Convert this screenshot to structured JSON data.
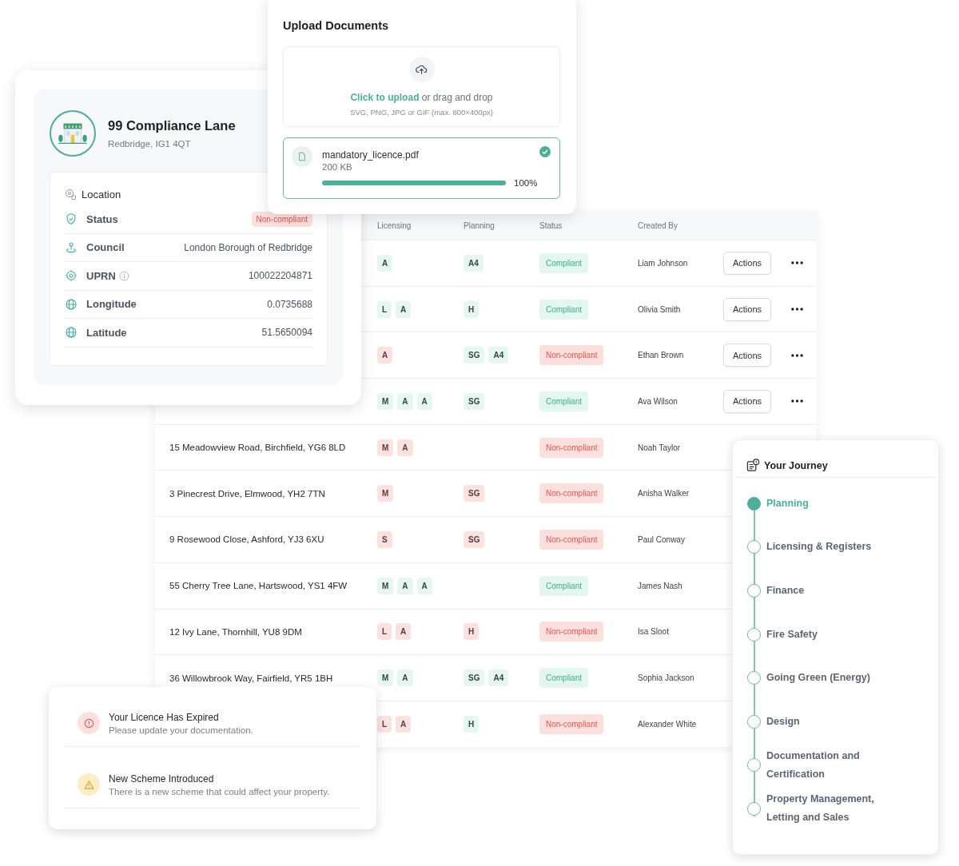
{
  "property": {
    "title": "99 Compliance Lane",
    "subtitle": "Redbridge, IG1 4QT",
    "section": "Location",
    "rows": [
      {
        "kind": "status",
        "label": "Status",
        "value": "Non-compliant",
        "info": false
      },
      {
        "kind": "council",
        "label": "Council",
        "value": "London Borough of Redbridge",
        "info": false
      },
      {
        "kind": "uprn",
        "label": "UPRN",
        "value": "100022204871",
        "info": true
      },
      {
        "kind": "globe",
        "label": "Longitude",
        "value": "0.0735688",
        "info": false
      },
      {
        "kind": "globe",
        "label": "Latitude",
        "value": "51.5650094",
        "info": false
      }
    ]
  },
  "upload": {
    "title": "Upload Documents",
    "link": "Click to upload",
    "prompt": "or drag and drop",
    "hint": "SVG, PNG, JPG or GIF (max. 800×400px)",
    "file": {
      "name": "mandatory_licence.pdf",
      "size": "200 KB",
      "level": 1,
      "percent": "100%",
      "complete": true
    }
  },
  "table": {
    "columns": [
      "Licensing",
      "Planning",
      "Status",
      "Created By"
    ],
    "rows": [
      {
        "licensing": {
          "tags": [
            "A"
          ],
          "flagged": false
        },
        "planning": {
          "tags": [
            "A4"
          ],
          "flagged": false
        },
        "status": {
          "label": "Compliant",
          "compliant": true
        },
        "created_by": "Liam Johnson",
        "actions": "Actions"
      },
      {
        "licensing": {
          "tags": [
            "L",
            "A"
          ],
          "flagged": false
        },
        "planning": {
          "tags": [
            "H"
          ],
          "flagged": false
        },
        "status": {
          "label": "Compliant",
          "compliant": true
        },
        "created_by": "Olivia Smith",
        "actions": "Actions"
      },
      {
        "licensing": {
          "tags": [
            "A"
          ],
          "flagged": true
        },
        "planning": {
          "tags": [
            "SG",
            "A4"
          ],
          "flagged": false
        },
        "status": {
          "label": "Non-compliant",
          "compliant": false
        },
        "created_by": "Ethan Brown",
        "actions": "Actions"
      },
      {
        "licensing": {
          "tags": [
            "M",
            "A",
            "A"
          ],
          "flagged": false
        },
        "planning": {
          "tags": [
            "SG"
          ],
          "flagged": false
        },
        "status": {
          "label": "Compliant",
          "compliant": true
        },
        "created_by": "Ava Wilson",
        "actions": "Actions"
      },
      {
        "address": "15 Meadowview Road, Birchfield, YG6 8LD",
        "licensing": {
          "tags": [
            "M",
            "A"
          ],
          "flagged": true
        },
        "status": {
          "label": "Non-compliant",
          "compliant": false
        },
        "created_by": "Noah Taylor"
      },
      {
        "address": "3 Pinecrest Drive, Elmwood, YH2 7TN",
        "licensing": {
          "tags": [
            "M"
          ],
          "flagged": true
        },
        "planning": {
          "tags": [
            "SG"
          ],
          "flagged": true
        },
        "status": {
          "label": "Non-compliant",
          "compliant": false
        },
        "created_by": "Anisha Walker"
      },
      {
        "address": "9 Rosewood Close, Ashford, YJ3 6XU",
        "licensing": {
          "tags": [
            "S"
          ],
          "flagged": true
        },
        "planning": {
          "tags": [
            "SG"
          ],
          "flagged": true
        },
        "status": {
          "label": "Non-compliant",
          "compliant": false
        },
        "created_by": "Paul Conway"
      },
      {
        "address": "55 Cherry Tree Lane, Hartswood, YS1 4FW",
        "licensing": {
          "tags": [
            "M",
            "A",
            "A"
          ],
          "flagged": false
        },
        "status": {
          "label": "Compliant",
          "compliant": true
        },
        "created_by": "James Nash"
      },
      {
        "address": "12 Ivy Lane, Thornhill, YU8 9DM",
        "licensing": {
          "tags": [
            "L",
            "A"
          ],
          "flagged": true
        },
        "planning": {
          "tags": [
            "H"
          ],
          "flagged": true
        },
        "status": {
          "label": "Non-compliant",
          "compliant": false
        },
        "created_by": "Isa Sloot"
      },
      {
        "address": "36 Willowbrook Way, Fairfield, YR5 1BH",
        "licensing": {
          "tags": [
            "M",
            "A"
          ],
          "flagged": false
        },
        "planning": {
          "tags": [
            "SG",
            "A4"
          ],
          "flagged": false
        },
        "status": {
          "label": "Compliant",
          "compliant": true
        },
        "created_by": "Sophia Jackson"
      },
      {
        "licensing": {
          "tags": [
            "L",
            "A"
          ],
          "flagged": true
        },
        "planning": {
          "tags": [
            "H"
          ],
          "flagged": false
        },
        "status": {
          "label": "Non-compliant",
          "compliant": false
        },
        "created_by": "Alexander White"
      }
    ]
  },
  "journey": {
    "title": "Your Journey",
    "steps": [
      {
        "label": "Planning",
        "selected": true
      },
      {
        "label": "Licensing & Registers",
        "selected": false
      },
      {
        "label": "Finance",
        "selected": false
      },
      {
        "label": "Fire Safety",
        "selected": false
      },
      {
        "label": "Going Green (Energy)",
        "selected": false
      },
      {
        "label": "Design",
        "selected": false
      },
      {
        "label": "Documentation and Certification",
        "selected": false
      },
      {
        "label": "Property Management, Letting and Sales",
        "selected": false
      }
    ]
  },
  "alerts": [
    {
      "kind": "error",
      "title": "Your Licence Has Expired",
      "message": "Please update your documentation."
    },
    {
      "kind": "warning",
      "title": "New Scheme Introduced",
      "message": "There is a new scheme that could affect your property."
    }
  ]
}
